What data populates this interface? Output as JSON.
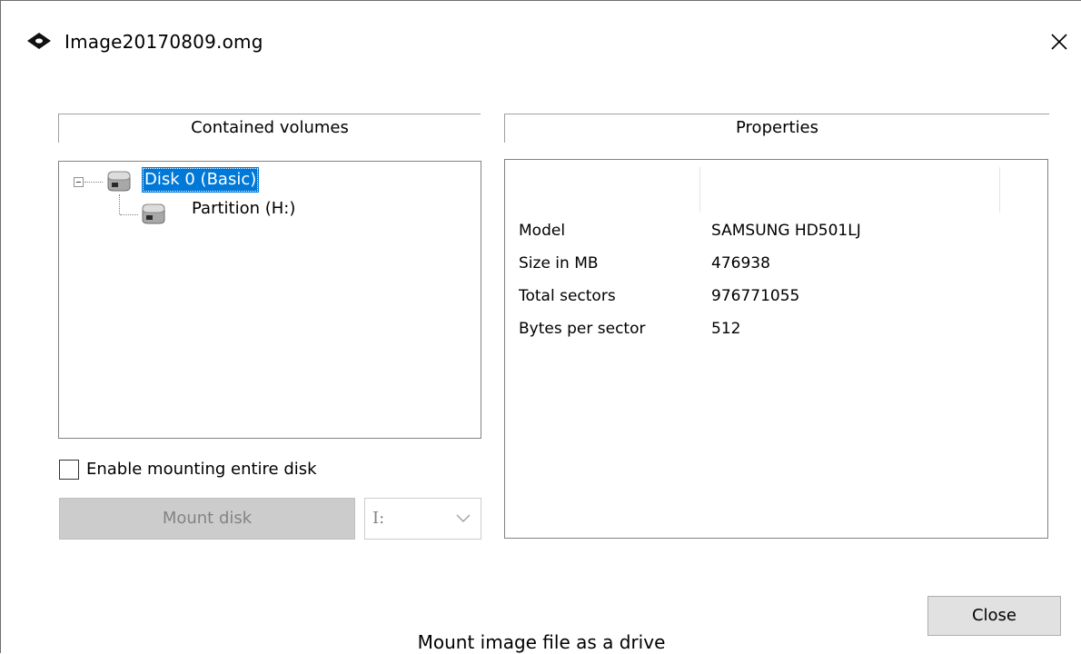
{
  "window": {
    "title": "Image20170809.omg",
    "title_icon": "disk-image-icon",
    "close_icon": "close-icon"
  },
  "volumes": {
    "header": "Contained volumes",
    "tree": [
      {
        "label": "Disk 0 (Basic)",
        "icon": "hard-disk-icon",
        "selected": true,
        "expanded": true
      },
      {
        "label": "Partition (H:)",
        "icon": "hard-disk-icon",
        "selected": false
      }
    ],
    "enable_mount_label": "Enable mounting entire disk",
    "enable_mount_checked": false,
    "mount_button": "Mount disk",
    "drive_letter": "I:"
  },
  "properties": {
    "header": "Properties",
    "rows": [
      {
        "key": "Model",
        "value": "SAMSUNG HD501LJ"
      },
      {
        "key": "Size in MB",
        "value": "476938"
      },
      {
        "key": "Total sectors",
        "value": "976771055"
      },
      {
        "key": "Bytes per sector",
        "value": "512"
      }
    ]
  },
  "footer": {
    "close_button": "Close",
    "caption": "Mount image file as a drive"
  },
  "colors": {
    "selection": "#0078d7",
    "disabled_button": "#cccccc",
    "button_face": "#e1e1e1"
  }
}
